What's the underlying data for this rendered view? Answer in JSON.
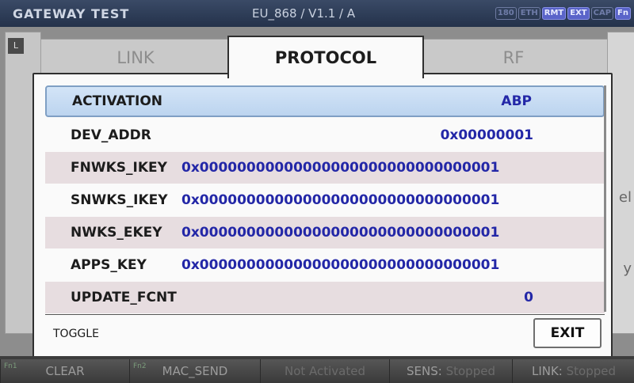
{
  "titlebar": {
    "app_title": "GATEWAY TEST",
    "version": "EU_868 / V1.1 / A",
    "badges": [
      {
        "label": "180",
        "active": false
      },
      {
        "label": "ETH",
        "active": false
      },
      {
        "label": "RMT",
        "active": true
      },
      {
        "label": "EXT",
        "active": true
      },
      {
        "label": "CAP",
        "active": false
      },
      {
        "label": "Fn",
        "active": true
      }
    ]
  },
  "background": {
    "left_label": "L",
    "right_frag_1": "el",
    "right_frag_2": "y"
  },
  "tabs": [
    {
      "label": "LINK"
    },
    {
      "label": "PROTOCOL"
    },
    {
      "label": "RF"
    }
  ],
  "rows": [
    {
      "label": "ACTIVATION",
      "value": "ABP"
    },
    {
      "label": "DEV_ADDR",
      "value": "0x00000001"
    },
    {
      "label": "FNWKS_IKEY",
      "value": "0x00000000000000000000000000000001"
    },
    {
      "label": "SNWKS_IKEY",
      "value": "0x00000000000000000000000000000001"
    },
    {
      "label": "NWKS_EKEY",
      "value": "0x00000000000000000000000000000001"
    },
    {
      "label": "APPS_KEY",
      "value": "0x00000000000000000000000000000001"
    },
    {
      "label": "UPDATE_FCNT",
      "value": "0"
    }
  ],
  "footer": {
    "hint": "TOGGLE",
    "exit_label": "EXIT"
  },
  "softkeys": {
    "clear": {
      "fn": "Fn1",
      "label": "CLEAR"
    },
    "mac_send": {
      "fn": "Fn2",
      "label": "MAC_SEND"
    },
    "status": "Not Activated",
    "sens_label": "SENS:",
    "sens_value": "Stopped",
    "link_label": "LINK:",
    "link_value": "Stopped"
  },
  "colors": {
    "accent_value": "#2327a7",
    "selected_row": "#c7dcf3",
    "alt_row": "#e7dde0"
  }
}
